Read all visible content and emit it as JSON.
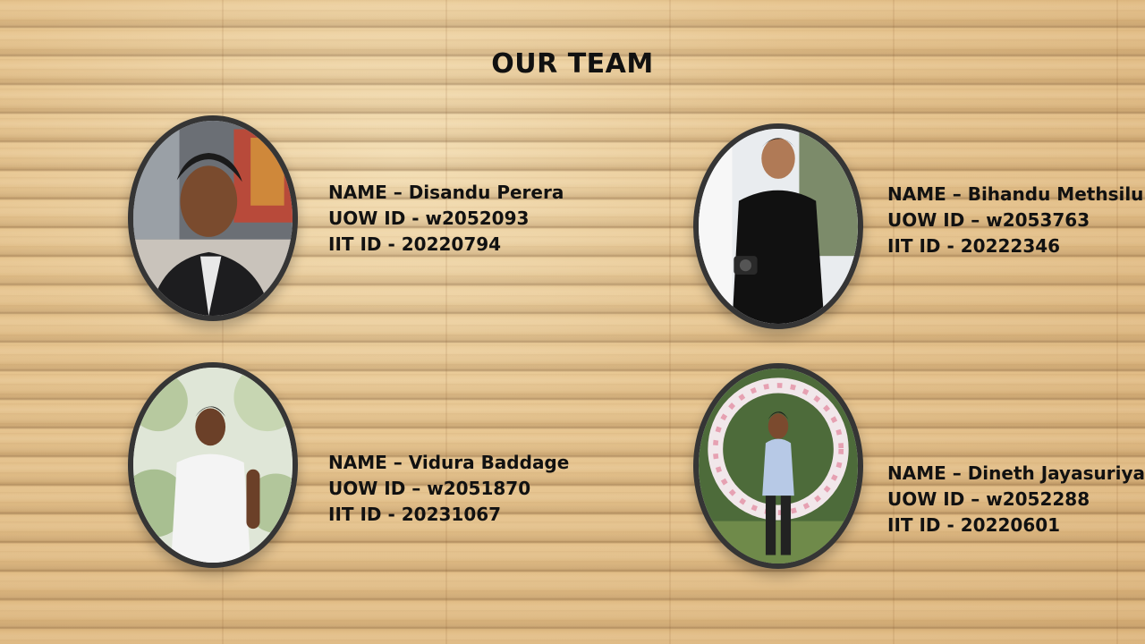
{
  "title": "OUR TEAM",
  "members": [
    {
      "name_line": "NAME – Disandu Perera",
      "uow_line": "UOW ID -  w2052093",
      "iit_line": "IIT ID - 20220794"
    },
    {
      "name_line": "NAME – Bihandu Methsilu",
      "uow_line": "UOW ID – w2053763",
      "iit_line": "IIT ID - 20222346"
    },
    {
      "name_line": "NAME – Vidura Baddage",
      "uow_line": "UOW ID – w2051870",
      "iit_line": "IIT ID - 20231067"
    },
    {
      "name_line": "NAME – Dineth Jayasuriya",
      "uow_line": "UOW ID – w2052288",
      "iit_line": "IIT ID - 20220601"
    }
  ],
  "colors": {
    "text": "#111111",
    "frame": "#353535",
    "wood_light": "#f3ddb2",
    "wood_dark": "#ddb57c"
  }
}
